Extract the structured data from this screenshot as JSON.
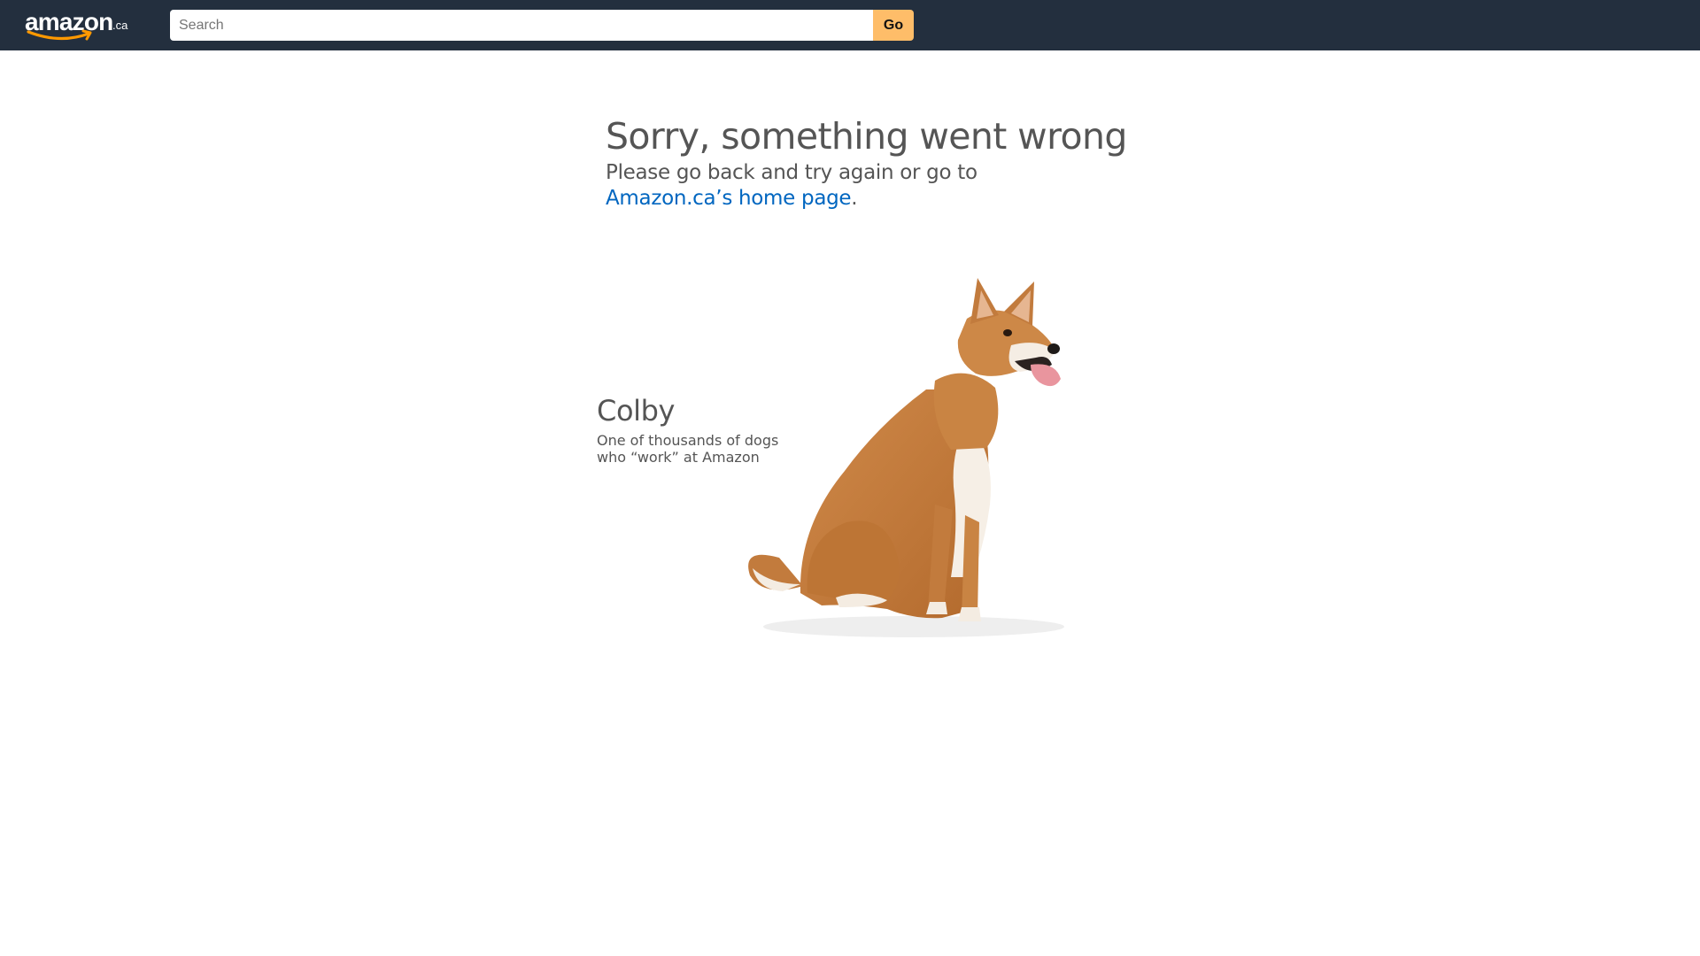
{
  "header": {
    "logo": {
      "wordmark": "amazon",
      "tld": ".ca"
    },
    "search": {
      "placeholder": "Search",
      "value": "",
      "button_label": "Go"
    }
  },
  "error": {
    "title": "Sorry, something went wrong",
    "message": "Please go back and try again or go to",
    "link_text": "Amazon.ca’s home page",
    "trailing_punctuation": "."
  },
  "dog": {
    "name": "Colby",
    "caption_line1": "One of thousands of dogs",
    "caption_line2": "who “work” at Amazon"
  },
  "colors": {
    "header_bg": "#232f3e",
    "go_button": "#febd69",
    "link": "#0066c0",
    "smile": "#ff9900",
    "text": "#555555"
  }
}
